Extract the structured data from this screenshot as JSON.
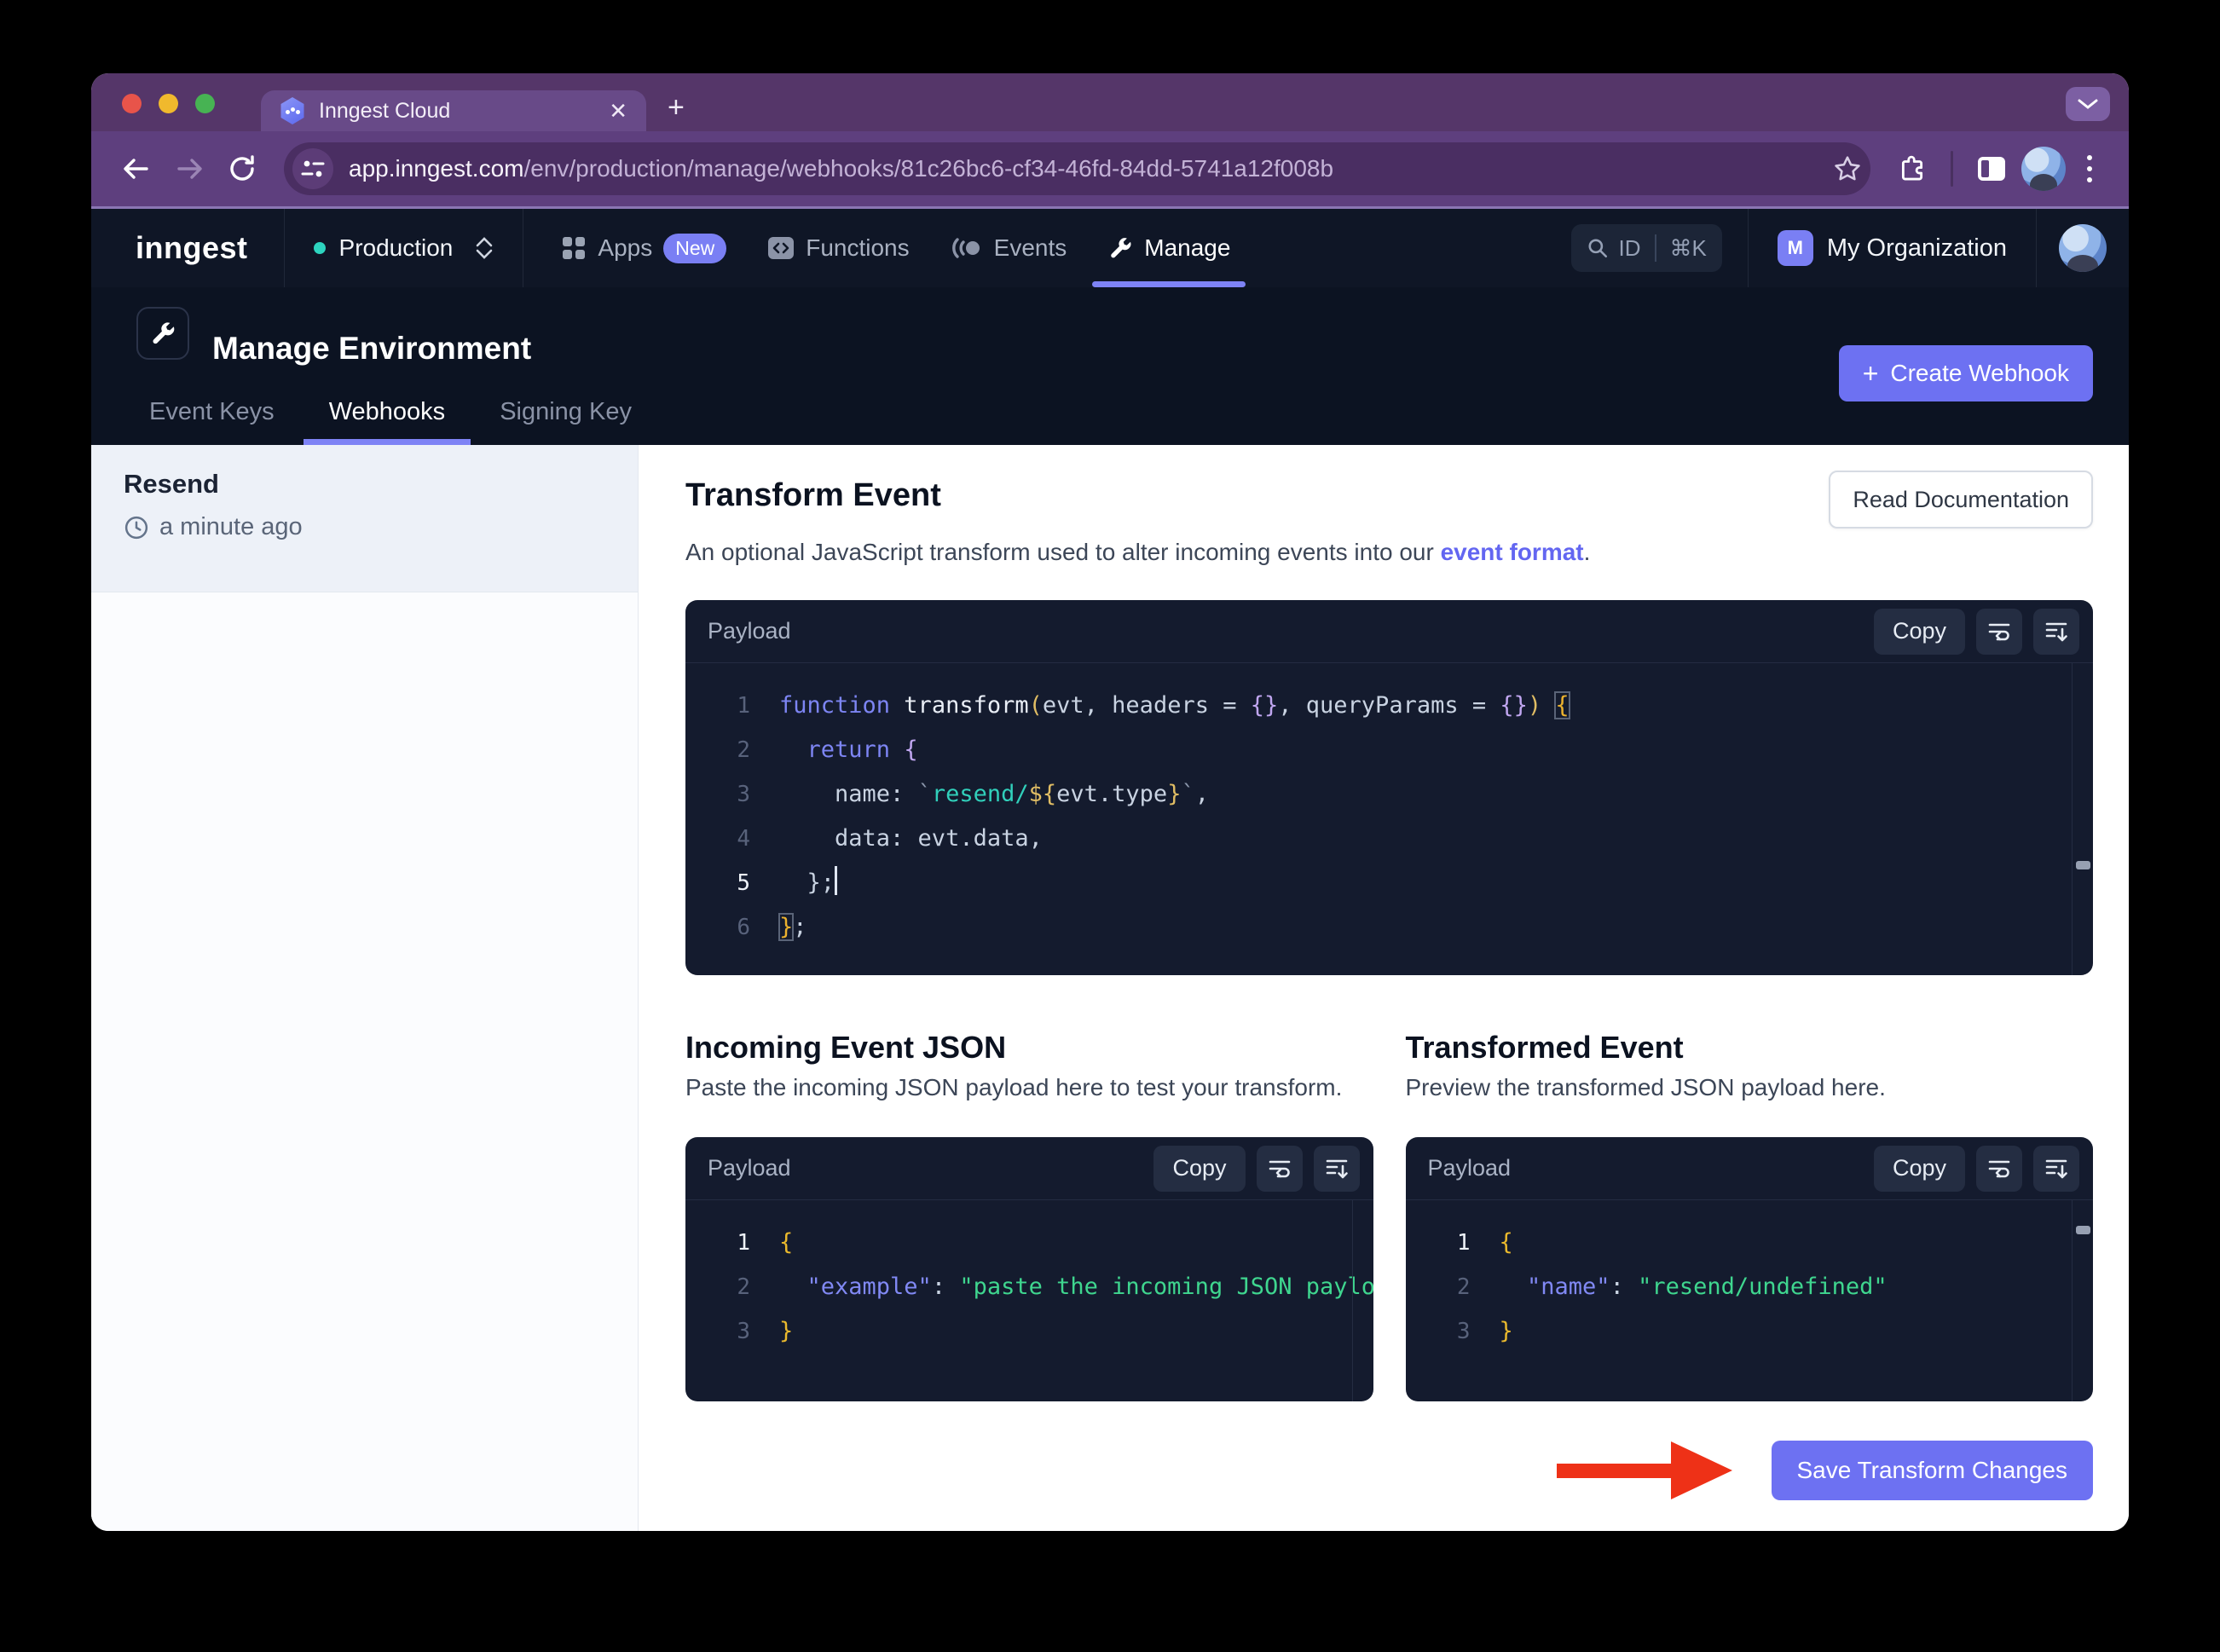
{
  "browser": {
    "tab_title": "Inngest Cloud",
    "url_host": "app.inngest.com",
    "url_path": "/env/production/manage/webhooks/81c26bc6-cf34-46fd-84dd-5741a12f008b"
  },
  "nav": {
    "logo": "inngest",
    "environment": "Production",
    "items": [
      {
        "label": "Apps",
        "badge": "New"
      },
      {
        "label": "Functions"
      },
      {
        "label": "Events"
      },
      {
        "label": "Manage"
      }
    ],
    "search": {
      "id_label": "ID",
      "shortcut": "⌘K"
    },
    "org": {
      "initial": "M",
      "name": "My Organization"
    }
  },
  "page_header": {
    "title": "Manage Environment",
    "create_button_icon": "+",
    "create_button_label": "Create Webhook"
  },
  "page_tabs": [
    {
      "label": "Event Keys"
    },
    {
      "label": "Webhooks"
    },
    {
      "label": "Signing Key"
    }
  ],
  "sidebar": {
    "webhook_name": "Resend",
    "webhook_time": "a minute ago"
  },
  "transform": {
    "title": "Transform Event",
    "desc_prefix": "An optional JavaScript transform used to alter incoming events into our ",
    "desc_link": "event format",
    "desc_suffix": ".",
    "read_docs_label": "Read Documentation",
    "editor": {
      "label": "Payload",
      "copy_label": "Copy",
      "active_line": 5,
      "lines": [
        [
          {
            "t": "function",
            "c": "kw"
          },
          {
            "t": " transform",
            "c": "fn"
          },
          {
            "t": "(",
            "c": "paren"
          },
          {
            "t": "evt",
            "c": "plain"
          },
          {
            "t": ", ",
            "c": "plain"
          },
          {
            "t": "headers",
            "c": "plain"
          },
          {
            "t": " = ",
            "c": "plain"
          },
          {
            "t": "{}",
            "c": "brace"
          },
          {
            "t": ", ",
            "c": "plain"
          },
          {
            "t": "queryParams",
            "c": "plain"
          },
          {
            "t": " = ",
            "c": "plain"
          },
          {
            "t": "{}",
            "c": "brace"
          },
          {
            "t": ")",
            "c": "paren"
          },
          {
            "t": " ",
            "c": "plain"
          },
          {
            "t": "{",
            "c": "bmatch"
          }
        ],
        [
          {
            "t": "  ",
            "c": "plain"
          },
          {
            "t": "return",
            "c": "kw"
          },
          {
            "t": " ",
            "c": "plain"
          },
          {
            "t": "{",
            "c": "brace"
          }
        ],
        [
          {
            "t": "    name: ",
            "c": "plain"
          },
          {
            "t": "`",
            "c": "tick"
          },
          {
            "t": "resend/",
            "c": "str"
          },
          {
            "t": "${",
            "c": "tpl"
          },
          {
            "t": "evt.type",
            "c": "plain"
          },
          {
            "t": "}",
            "c": "tpl"
          },
          {
            "t": "`",
            "c": "tick"
          },
          {
            "t": ",",
            "c": "plain"
          }
        ],
        [
          {
            "t": "    data: evt.data,",
            "c": "plain"
          }
        ],
        [
          {
            "t": "  };",
            "c": "plain"
          },
          {
            "c": "cursor"
          }
        ],
        [
          {
            "t": "}",
            "c": "bmatch"
          },
          {
            "t": ";",
            "c": "plain"
          }
        ]
      ]
    }
  },
  "incoming": {
    "title": "Incoming Event JSON",
    "desc": "Paste the incoming JSON payload here to test your transform.",
    "editor": {
      "label": "Payload",
      "copy_label": "Copy",
      "active_line": 1,
      "lines": [
        [
          {
            "t": "{",
            "c": "ybrace"
          }
        ],
        [
          {
            "t": "  ",
            "c": "plain"
          },
          {
            "t": "\"example\"",
            "c": "jkey"
          },
          {
            "t": ": ",
            "c": "plain"
          },
          {
            "t": "\"paste the incoming JSON payload her",
            "c": "jstr"
          }
        ],
        [
          {
            "t": "}",
            "c": "ybrace"
          }
        ]
      ]
    }
  },
  "transformed": {
    "title": "Transformed Event",
    "desc": "Preview the transformed JSON payload here.",
    "editor": {
      "label": "Payload",
      "copy_label": "Copy",
      "active_line": 1,
      "lines": [
        [
          {
            "t": "{",
            "c": "ybrace"
          }
        ],
        [
          {
            "t": "  ",
            "c": "plain"
          },
          {
            "t": "\"name\"",
            "c": "jkey"
          },
          {
            "t": ": ",
            "c": "plain"
          },
          {
            "t": "\"resend/undefined\"",
            "c": "jstr"
          }
        ],
        [
          {
            "t": "}",
            "c": "ybrace"
          }
        ]
      ]
    }
  },
  "save_button_label": "Save Transform Changes",
  "colors": {
    "accent": "#6d71f2",
    "tab_underline": "#7e83f5",
    "arrow_red": "#ee3117",
    "chrome_frame": "#553669",
    "chrome_toolbar": "#5e3f7e",
    "nav_bg": "#0f1626",
    "editor_bg": "#141b2e",
    "string_teal": "#31d0bb",
    "json_green": "#3fd68f",
    "keyword_indigo": "#7d85f3",
    "env_dot_teal": "#2dd4bf"
  }
}
